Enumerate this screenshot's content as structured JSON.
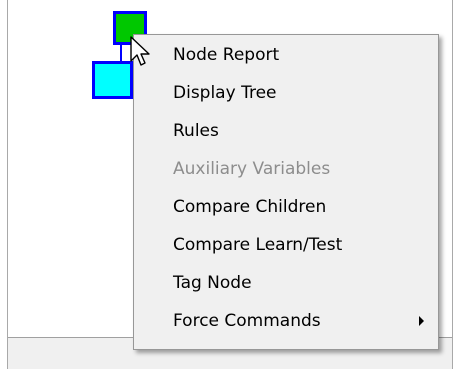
{
  "context_menu": {
    "items": [
      {
        "label": "Node Report",
        "enabled": true
      },
      {
        "label": "Display Tree",
        "enabled": true
      },
      {
        "label": "Rules",
        "enabled": true
      },
      {
        "label": "Auxiliary Variables",
        "enabled": false
      },
      {
        "label": "Compare Children",
        "enabled": true
      },
      {
        "label": "Compare Learn/Test",
        "enabled": true
      },
      {
        "label": "Tag Node",
        "enabled": true
      },
      {
        "label": "Force Commands",
        "enabled": true,
        "has_submenu": true
      }
    ]
  },
  "tree": {
    "selected_node_color": "#00c800",
    "child_node_color": "#00ffff",
    "node_border_color": "#0000ff"
  }
}
